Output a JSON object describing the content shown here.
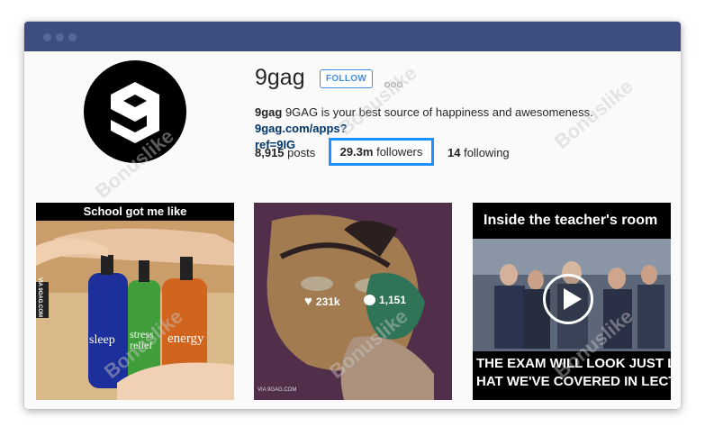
{
  "profile": {
    "username": "9gag",
    "follow_label": "FOLLOW",
    "more_icon": "more-dots-icon",
    "bio_name": "9gag",
    "bio_text": " 9GAG is your best source of happiness and awesomeness. ",
    "bio_link_line1": "9gag.com/apps?",
    "bio_link_line2": "ref=9IG"
  },
  "stats": {
    "posts_count": "8,915",
    "posts_label": " posts",
    "followers_count": "29.3m",
    "followers_label": " followers",
    "following_count": "14",
    "following_label": " following"
  },
  "posts": [
    {
      "caption": "School got me like",
      "bottle_labels": [
        "sleep",
        "stress relief",
        "energy"
      ],
      "side_tag": "VIA 9GAG.COM"
    },
    {
      "likes": "231k",
      "comments": "1,151",
      "footer_tag": "VIA 9GAG.COM"
    },
    {
      "caption_top": "Inside the teacher's room",
      "caption_bottom_1": "THE EXAM WILL LOOK JUST LIK",
      "caption_bottom_2": "HAT WE'VE COVERED IN LECTU"
    }
  ],
  "watermark": "Bonuslike",
  "colors": {
    "titlebar": "#3d4d80",
    "accent": "#3f8ee7",
    "highlight_border": "#1e90ff",
    "link": "#003569"
  }
}
